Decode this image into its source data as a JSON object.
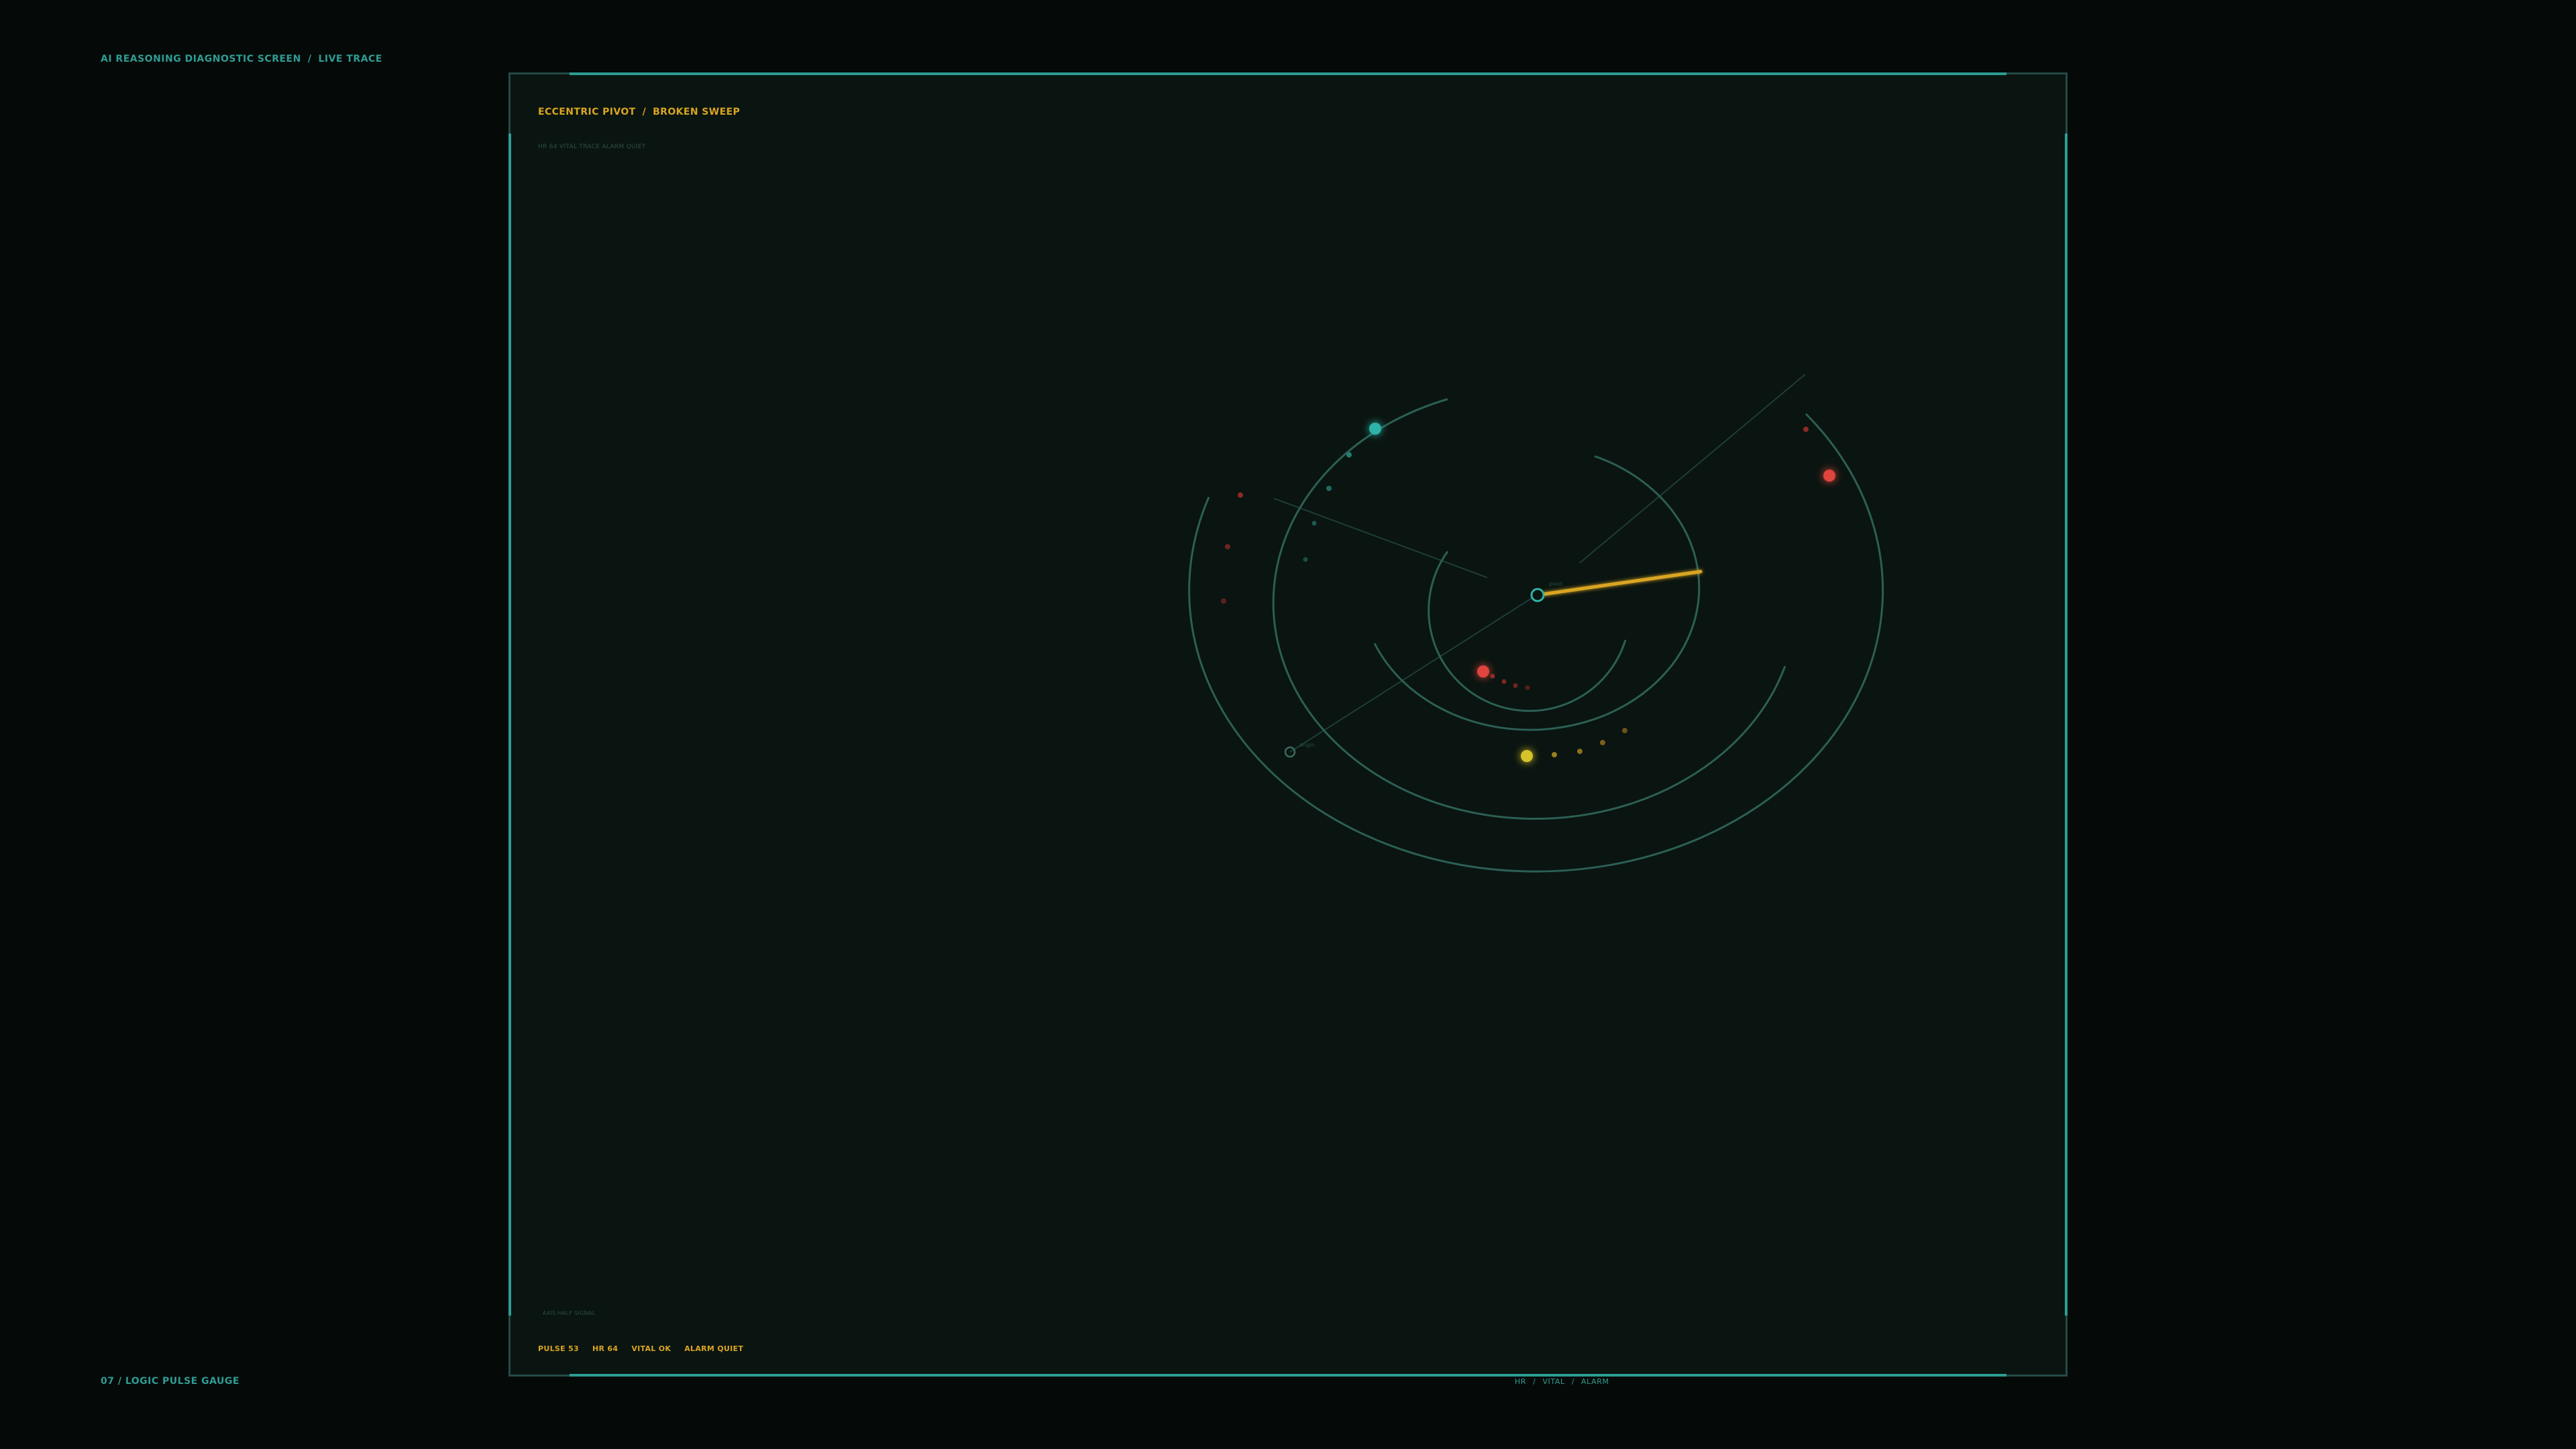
{
  "header": {
    "screen_title": "AI REASONING DIAGNOSTIC SCREEN",
    "screen_mode": "LIVE TRACE"
  },
  "footer": {
    "gauge_label": "07 / LOGIC PULSE GAUGE"
  },
  "panel": {
    "title_left": "ECCENTRIC PIVOT",
    "title_right": "BROKEN SWEEP",
    "subtitle": "HR 64   VITAL TRACE   ALARM QUIET",
    "axis_label": "AXIS HALF SIGNAL",
    "status": {
      "pulse": "PULSE 53",
      "hr": "HR 64",
      "vital": "VITAL OK",
      "alarm": "ALARM QUIET"
    },
    "legend": [
      "HR",
      "VITAL",
      "ALARM"
    ]
  },
  "gauge": {
    "pivot_label": "pivot",
    "origin_label": "origin",
    "colors": {
      "ring": "#2c5f54",
      "needle": "#d9a520",
      "pivot": "#2fb3a8",
      "teal_node": "#2fb3a8",
      "red_node": "#e0443e",
      "yellow_node": "#d6c22a",
      "accent": "#2d9d94"
    },
    "needle_angle_deg": -8
  }
}
